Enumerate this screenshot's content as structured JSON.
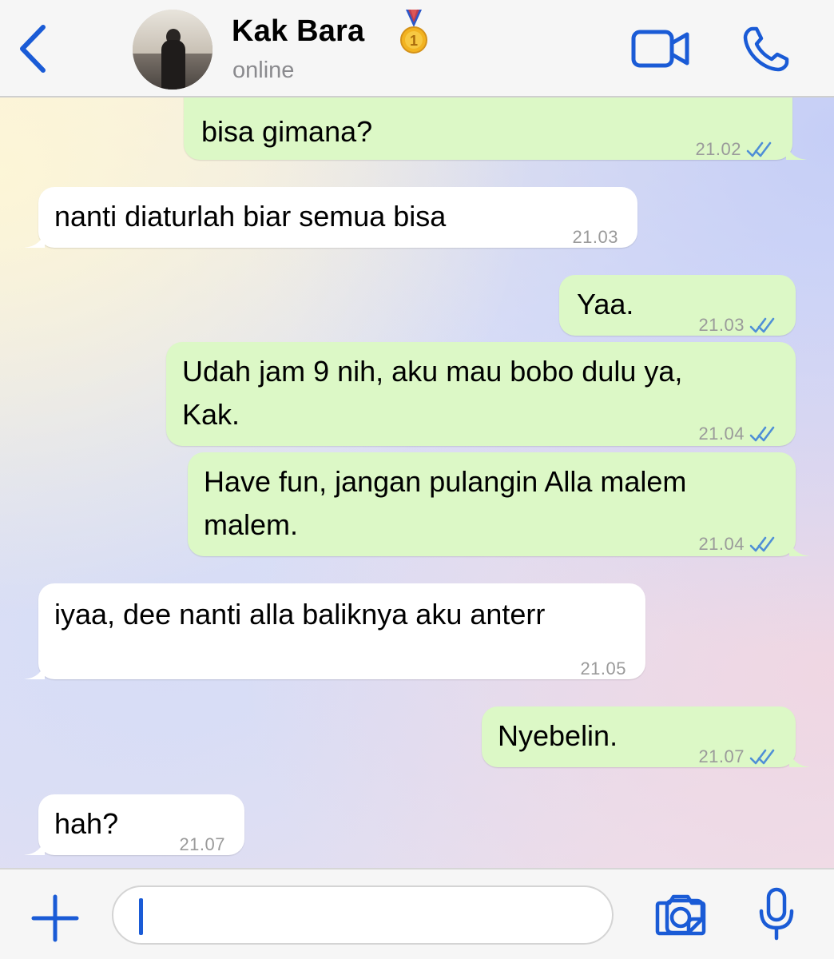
{
  "header": {
    "contact_name": "Kak Bara",
    "status": "online",
    "icons": [
      "back-chevron-icon",
      "medal-icon",
      "video-call-icon",
      "phone-icon"
    ]
  },
  "messages": [
    {
      "direction": "out",
      "text": "bisa gimana?",
      "time": "21.02",
      "status": "read"
    },
    {
      "direction": "in",
      "text": "nanti diaturlah biar semua bisa",
      "time": "21.03"
    },
    {
      "direction": "out",
      "text": "Yaa.",
      "time": "21.03",
      "status": "read"
    },
    {
      "direction": "out",
      "text": "Udah jam 9 nih, aku mau bobo dulu ya,\nKak.",
      "time": "21.04",
      "status": "read"
    },
    {
      "direction": "out",
      "text": "Have fun, jangan pulangin Alla malem\nmalem.",
      "time": "21.04",
      "status": "read"
    },
    {
      "direction": "in",
      "text": "iyaa, dee nanti alla baliknya aku anterr",
      "time": "21.05"
    },
    {
      "direction": "out",
      "text": "Nyebelin.",
      "time": "21.07",
      "status": "read"
    },
    {
      "direction": "in",
      "text": "hah?",
      "time": "21.07"
    }
  ],
  "input": {
    "value": "",
    "icons": [
      "plus-icon",
      "sticker-icon",
      "camera-icon",
      "microphone-icon"
    ]
  },
  "colors": {
    "accent": "#1a5bd6",
    "outgoing_bubble": "#dcf8c6",
    "incoming_bubble": "#ffffff",
    "read_ticks": "#4f8fd6"
  }
}
